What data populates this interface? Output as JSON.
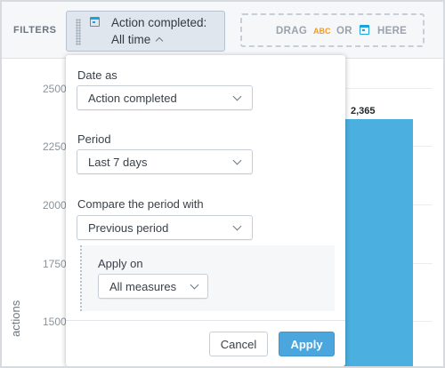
{
  "filter_bar": {
    "label": "FILTERS",
    "date_filter": {
      "title": "Action completed:",
      "value": "All time"
    },
    "dropzone": {
      "drag": "DRAG",
      "abc": "ABC",
      "or": "OR",
      "here": "HERE"
    }
  },
  "chart": {
    "y_axis_title": "actions",
    "y_ticks": [
      "2500",
      "2250",
      "2000",
      "1750",
      "1500"
    ],
    "bar_label": "2,365"
  },
  "chart_data": {
    "type": "bar",
    "values": [
      2365
    ],
    "ylabel": "actions",
    "ylim": [
      1375,
      2625
    ],
    "colors": [
      "#4bb0e0"
    ]
  },
  "dropdown": {
    "date_as": {
      "label": "Date as",
      "value": "Action completed"
    },
    "period": {
      "label": "Period",
      "value": "Last 7 days"
    },
    "compare": {
      "label": "Compare the period with",
      "value": "Previous period"
    },
    "apply_on": {
      "label": "Apply on",
      "value": "All measures"
    },
    "cancel_label": "Cancel",
    "apply_label": "Apply"
  },
  "colors": {
    "accent": "#4aa6dd",
    "bar": "#4bb0e0",
    "calendar_icon": "#1aa3dd",
    "abc_icon": "#f49b23"
  },
  "icons": [
    "drag-handle-icon",
    "calendar-icon",
    "chevron-up-icon",
    "chevron-down-icon",
    "abc-attribute-icon"
  ]
}
